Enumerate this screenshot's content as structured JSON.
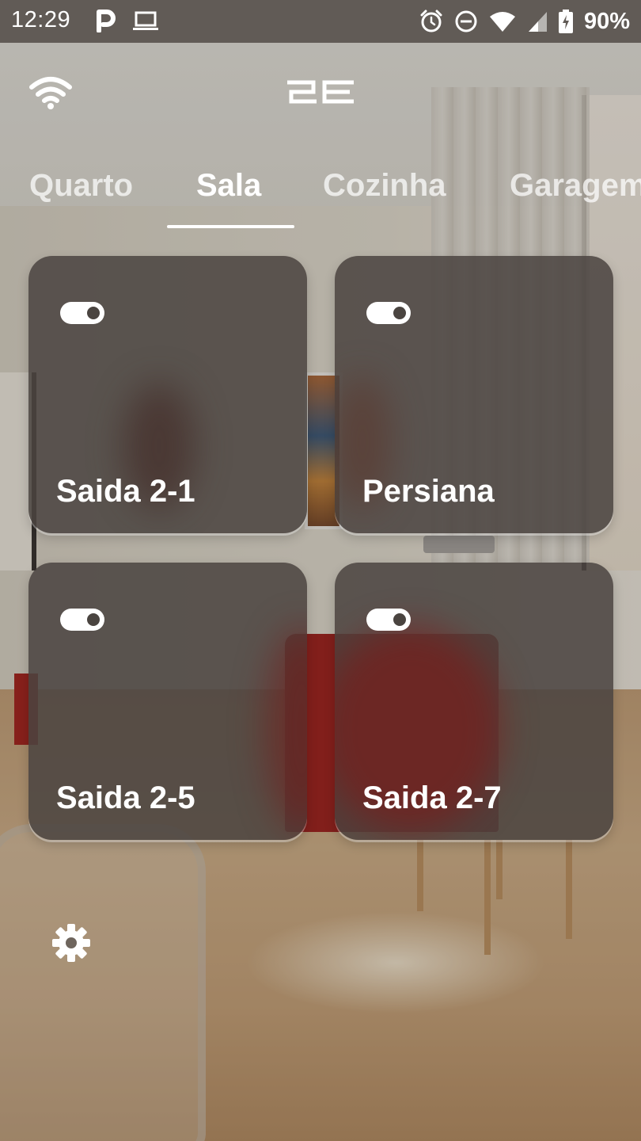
{
  "status_bar": {
    "time": "12:29",
    "notification_icons": [
      "parking-p-icon",
      "laptop-icon"
    ],
    "system_icons": [
      "alarm-icon",
      "do-not-disturb-icon",
      "wifi-signal-icon",
      "cell-signal-icon",
      "battery-charging-icon"
    ],
    "battery": "90%"
  },
  "header": {
    "wifi_icon": "wifi-icon",
    "logo_text": "2E"
  },
  "tabs": [
    {
      "label": "Quarto",
      "active": false
    },
    {
      "label": "Sala",
      "active": true
    },
    {
      "label": "Cozinha",
      "active": false
    },
    {
      "label": "Garagem",
      "active": false
    }
  ],
  "cards": [
    {
      "label": "Saida 2-1",
      "icon": "toggle-on-icon",
      "state": "on"
    },
    {
      "label": "Persiana",
      "icon": "toggle-on-icon",
      "state": "on"
    },
    {
      "label": "Saida 2-5",
      "icon": "toggle-on-icon",
      "state": "on"
    },
    {
      "label": "Saida 2-7",
      "icon": "toggle-on-icon",
      "state": "on"
    }
  ],
  "footer": {
    "settings_icon": "gear-icon"
  },
  "colors": {
    "status_bar_bg": "#615b56",
    "card_bg": "#4a4440",
    "text_primary": "#ffffff",
    "tab_inactive": "#ffffffb8",
    "sofa_red": "#a2231f"
  }
}
